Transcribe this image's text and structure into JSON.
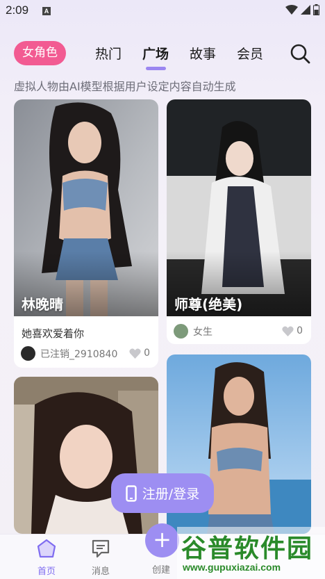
{
  "status_bar": {
    "time": "2:09",
    "notification_letter": "A",
    "icons": [
      "wifi-icon",
      "signal-icon",
      "battery-icon"
    ]
  },
  "header": {
    "gender_filter": "女角色",
    "tabs": [
      {
        "label": "热门",
        "active": false
      },
      {
        "label": "广场",
        "active": true
      },
      {
        "label": "故事",
        "active": false
      },
      {
        "label": "会员",
        "active": false
      }
    ],
    "search_icon": "search-icon",
    "subtitle": "虚拟人物由AI模型根据用户设定内容自动生成"
  },
  "cards": [
    {
      "name": "林晚晴",
      "description": "她喜欢爱着你",
      "author": "已注销_2910840",
      "likes": "0"
    },
    {
      "name": "师尊(绝美)",
      "description": "",
      "author": "女生",
      "likes": "0"
    },
    {
      "name": "",
      "description": "",
      "author": "",
      "likes": ""
    },
    {
      "name": "",
      "description": "",
      "author": "",
      "likes": ""
    }
  ],
  "register_button": {
    "label": "注册/登录",
    "icon": "phone-icon"
  },
  "bottom_nav": {
    "items": [
      {
        "label": "首页",
        "icon": "home-icon",
        "active": true
      },
      {
        "label": "消息",
        "icon": "message-icon",
        "active": false
      },
      {
        "label": "创建",
        "icon": "plus-icon",
        "active": false
      }
    ]
  },
  "watermark": {
    "title": "谷普软件园",
    "url": "www.gupuxiazai.com"
  },
  "colors": {
    "accent": "#9d8ef2",
    "pink": "#f25b92",
    "active_nav": "#7f6cf0"
  }
}
